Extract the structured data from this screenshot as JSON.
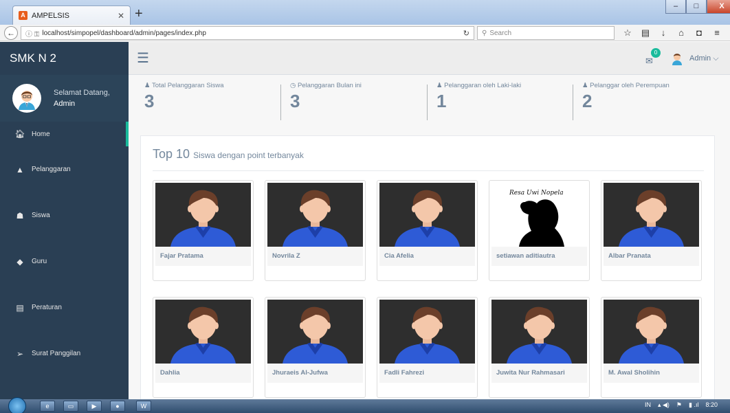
{
  "browser": {
    "tab_title": "AMPELSIS",
    "url": "localhost/simpopel/dashboard/admin/pages/index.php",
    "search_placeholder": "Search",
    "window_controls": [
      "–",
      "□",
      "X"
    ]
  },
  "sidebar": {
    "brand": "SMK N 2",
    "welcome_text": "Selamat Datang,",
    "user": "Admin",
    "items": [
      {
        "label": "Home",
        "icon": "home-icon"
      },
      {
        "label": "Pelanggaran",
        "icon": "warning-icon"
      },
      {
        "label": "Siswa",
        "icon": "users-icon"
      },
      {
        "label": "Guru",
        "icon": "tags-icon"
      },
      {
        "label": "Peraturan",
        "icon": "list-icon"
      },
      {
        "label": "Surat Panggilan",
        "icon": "send-icon"
      }
    ]
  },
  "topnav": {
    "notification_count": "0",
    "user_label": "Admin"
  },
  "stats": [
    {
      "label": "Total Pelanggaran Siswa",
      "value": "3",
      "icon": "user-icon"
    },
    {
      "label": "Pelanggaran Bulan ini",
      "value": "3",
      "icon": "clock-icon"
    },
    {
      "label": "Pelanggaran oleh Laki-laki",
      "value": "1",
      "icon": "user-icon"
    },
    {
      "label": "Pelanggar oleh Perempuan",
      "value": "2",
      "icon": "user-icon"
    }
  ],
  "panel": {
    "title_big": "Top 10",
    "title_small": "Siswa dengan point terbanyak"
  },
  "students": [
    {
      "name": "Fajar Pratama"
    },
    {
      "name": "Novrila Z"
    },
    {
      "name": "Cia Afelia"
    },
    {
      "name": "setiawan aditiautra",
      "photo_caption": "Resa Uwi Nopela"
    },
    {
      "name": "Albar Pranata"
    },
    {
      "name": "Dahlia"
    },
    {
      "name": "Jhuraeis Al-Jufwa"
    },
    {
      "name": "Fadli Fahrezi"
    },
    {
      "name": "Juwita Nur Rahmasari"
    },
    {
      "name": "M. Awal Sholihin"
    }
  ],
  "taskbar": {
    "lang": "IN",
    "time": "8:20"
  },
  "colors": {
    "sidebar_bg": "#2a3f54",
    "accent": "#1abb9c",
    "text_muted": "#73879c",
    "shirt_blue": "#2e5bd6"
  }
}
